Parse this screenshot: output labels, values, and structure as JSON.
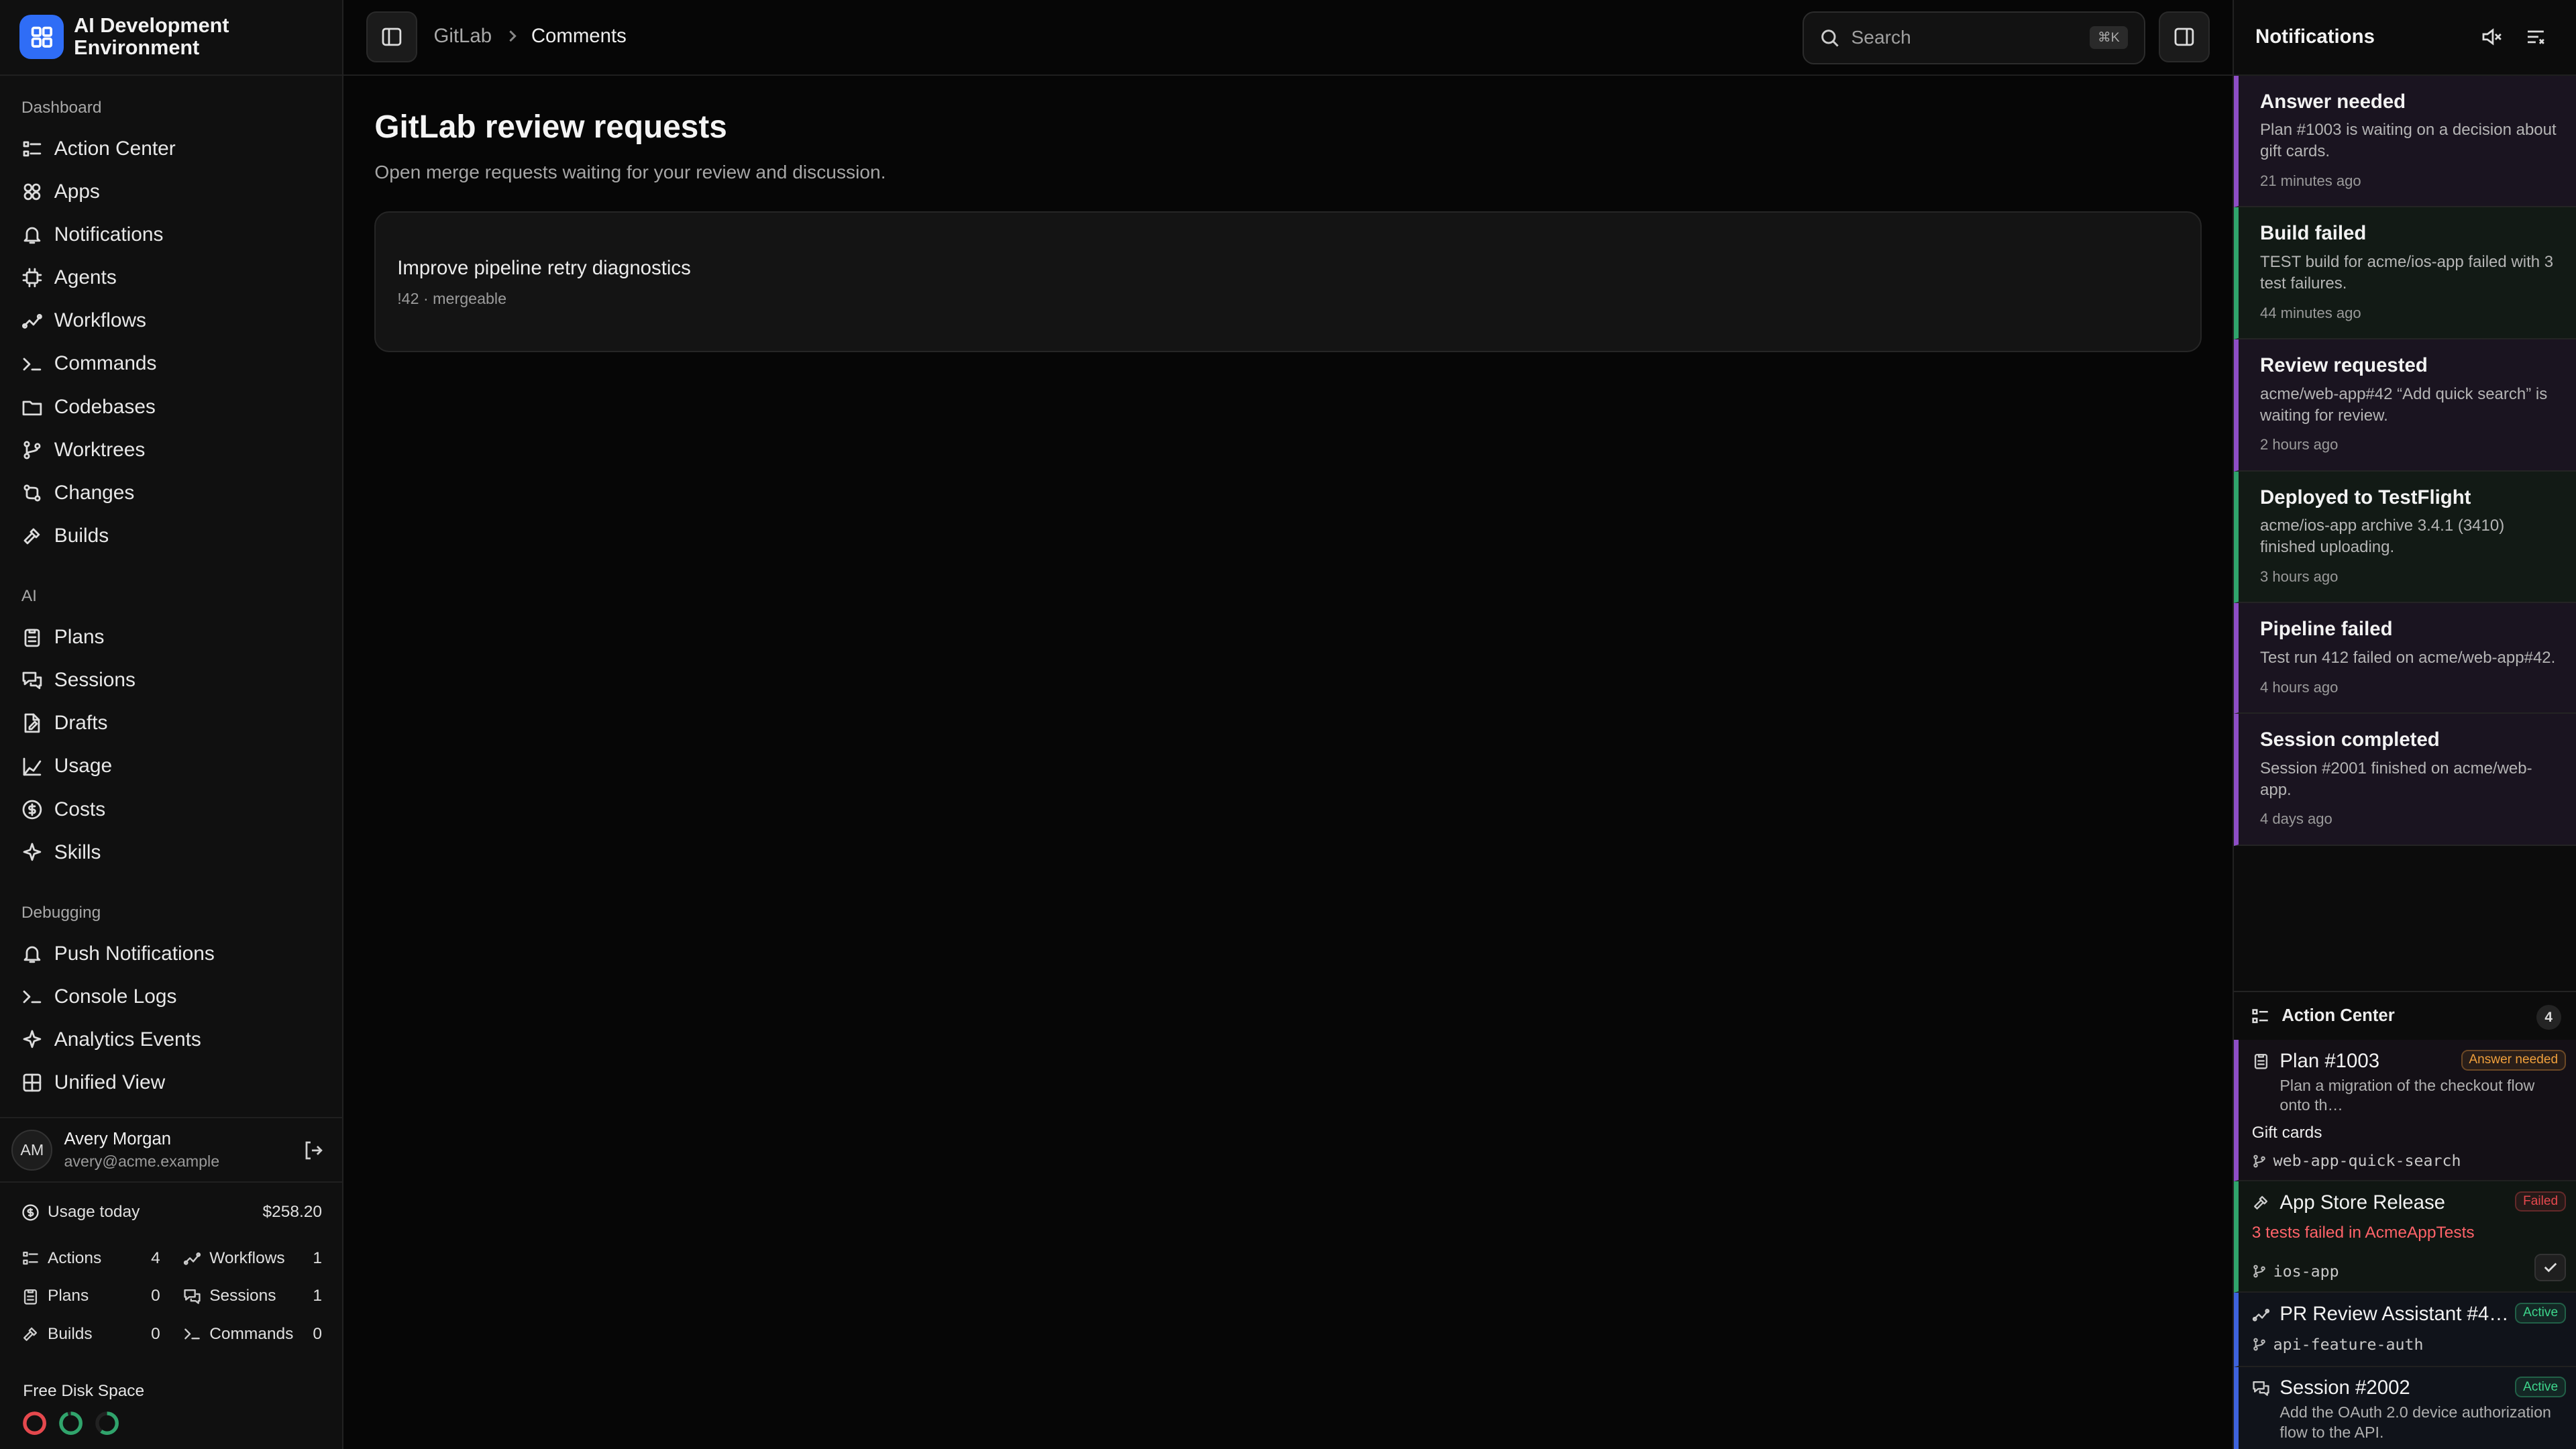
{
  "app": {
    "title": "AI Development Environment"
  },
  "sidebar": {
    "sections": [
      {
        "title": "Dashboard",
        "items": [
          {
            "label": "Action Center",
            "icon": "checklist-icon"
          },
          {
            "label": "Apps",
            "icon": "apps-icon"
          },
          {
            "label": "Notifications",
            "icon": "bell-icon"
          },
          {
            "label": "Agents",
            "icon": "cpu-icon"
          },
          {
            "label": "Workflows",
            "icon": "workflow-icon"
          },
          {
            "label": "Commands",
            "icon": "terminal-icon"
          },
          {
            "label": "Codebases",
            "icon": "folder-icon"
          },
          {
            "label": "Worktrees",
            "icon": "branch-icon"
          },
          {
            "label": "Changes",
            "icon": "diff-icon"
          },
          {
            "label": "Builds",
            "icon": "hammer-icon"
          }
        ]
      },
      {
        "title": "AI",
        "items": [
          {
            "label": "Plans",
            "icon": "clipboard-icon"
          },
          {
            "label": "Sessions",
            "icon": "chat-icon"
          },
          {
            "label": "Drafts",
            "icon": "draft-icon"
          },
          {
            "label": "Usage",
            "icon": "chart-icon"
          },
          {
            "label": "Costs",
            "icon": "dollar-icon"
          },
          {
            "label": "Skills",
            "icon": "sparkle-icon"
          }
        ]
      },
      {
        "title": "Debugging",
        "items": [
          {
            "label": "Push Notifications",
            "icon": "bell-icon"
          },
          {
            "label": "Console Logs",
            "icon": "terminal-icon"
          },
          {
            "label": "Analytics Events",
            "icon": "sparkle-icon"
          },
          {
            "label": "Unified View",
            "icon": "grid-icon"
          }
        ]
      }
    ],
    "user": {
      "initials": "AM",
      "name": "Avery Morgan",
      "email": "avery@acme.example"
    },
    "usage": {
      "label": "Usage today",
      "value": "$258.20",
      "stats": [
        {
          "label": "Actions",
          "value": "4",
          "icon": "checklist-icon"
        },
        {
          "label": "Workflows",
          "value": "1",
          "icon": "workflow-icon"
        },
        {
          "label": "Plans",
          "value": "0",
          "icon": "clipboard-icon"
        },
        {
          "label": "Sessions",
          "value": "1",
          "icon": "chat-icon"
        },
        {
          "label": "Builds",
          "value": "0",
          "icon": "hammer-icon"
        },
        {
          "label": "Commands",
          "value": "0",
          "icon": "terminal-icon"
        }
      ]
    },
    "disk": {
      "title": "Free Disk Space",
      "rings": [
        {
          "color": "#e5484d",
          "fraction": 1.0
        },
        {
          "color": "#30a46c",
          "fraction": 0.95
        },
        {
          "color": "#30a46c",
          "fraction": 0.6
        }
      ]
    }
  },
  "topbar": {
    "breadcrumb": [
      "GitLab",
      "Comments"
    ],
    "search_placeholder": "Search",
    "search_shortcut": "⌘K"
  },
  "main": {
    "title": "GitLab review requests",
    "subtitle": "Open merge requests waiting for your review and discussion.",
    "merge_requests": [
      {
        "title": "Improve pipeline retry diagnostics",
        "meta": "!42 · mergeable"
      }
    ]
  },
  "notifications": {
    "title": "Notifications",
    "items": [
      {
        "title": "Answer needed",
        "desc": "Plan #1003 is waiting on a decision about gift cards.",
        "ago": "21 minutes ago",
        "color": "#8e4ec6",
        "bg": "#1a1420"
      },
      {
        "title": "Build failed",
        "desc": "TEST build for acme/ios-app failed with 3 test failures.",
        "ago": "44 minutes ago",
        "color": "#30a46c",
        "bg": "#121a15"
      },
      {
        "title": "Review requested",
        "desc": "acme/web-app#42 “Add quick search” is waiting for review.",
        "ago": "2 hours ago",
        "color": "#8e4ec6",
        "bg": "#1a1420"
      },
      {
        "title": "Deployed to TestFlight",
        "desc": "acme/ios-app archive 3.4.1 (3410) finished uploading.",
        "ago": "3 hours ago",
        "color": "#30a46c",
        "bg": "#121a15"
      },
      {
        "title": "Pipeline failed",
        "desc": "Test run 412 failed on acme/web-app#42.",
        "ago": "4 hours ago",
        "color": "#8e4ec6",
        "bg": "#1a1420"
      },
      {
        "title": "Session completed",
        "desc": "Session #2001 finished on acme/web-app.",
        "ago": "4 days ago",
        "color": "#8e4ec6",
        "bg": "#1a1420"
      }
    ]
  },
  "action_center": {
    "title": "Action Center",
    "count": "4",
    "items": [
      {
        "title": "Plan #1003",
        "desc": "Plan a migration of the checkout flow onto th…",
        "extra": "Gift cards",
        "branch": "web-app-quick-search",
        "badge": "Answer needed",
        "badge_color": "#f0a03c",
        "color": "#8e4ec6",
        "icon": "clipboard-icon"
      },
      {
        "title": "App Store Release",
        "error": "3 tests failed in AcmeAppTests",
        "branch": "ios-app",
        "badge": "Failed",
        "badge_color": "#e5484d",
        "color": "#30a46c",
        "icon": "hammer-icon"
      },
      {
        "title": "PR Review Assistant #4…",
        "branch": "api-feature-auth",
        "badge": "Active",
        "badge_color": "#3dd68c",
        "color": "#3e63dd",
        "icon": "workflow-icon"
      },
      {
        "title": "Session #2002",
        "desc": "Add the OAuth 2.0 device authorization flow to the API.",
        "badge": "Active",
        "badge_color": "#3dd68c",
        "color": "#3e63dd",
        "icon": "chat-icon"
      }
    ]
  }
}
